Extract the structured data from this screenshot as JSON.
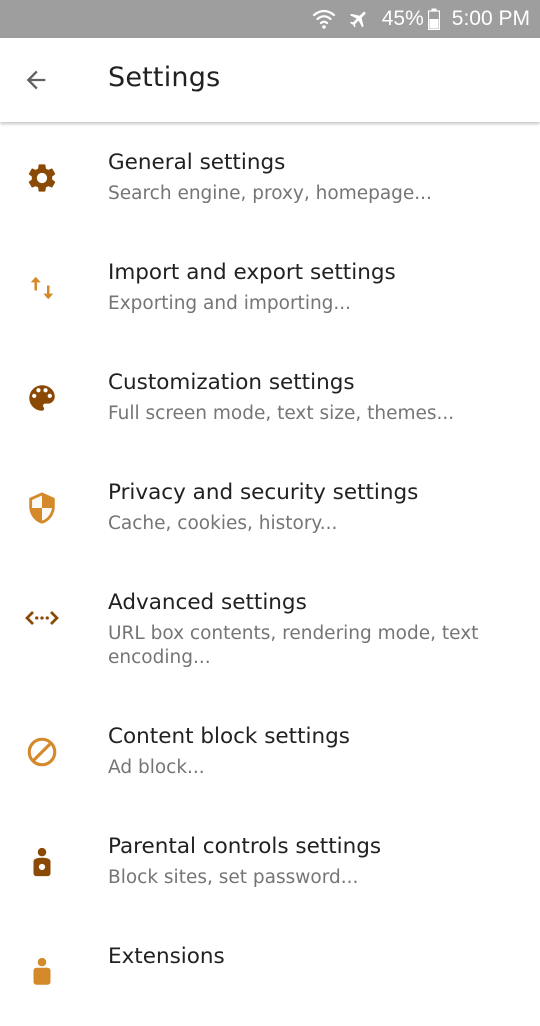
{
  "status_bar": {
    "battery": "45%",
    "time": "5:00 PM",
    "icons": [
      "wifi-icon",
      "airplane-mode-icon",
      "battery-icon"
    ]
  },
  "app_bar": {
    "title": "Settings",
    "back_icon": "back-arrow-icon"
  },
  "colors": {
    "accent_dark": "#8a4a06",
    "accent_light": "#d4892a",
    "status_bar": "#9e9e9e",
    "title_text": "#212121",
    "subtitle_text": "#757575"
  },
  "settings": {
    "items": [
      {
        "title": "General settings",
        "subtitle": "Search engine, proxy, homepage...",
        "icon": "gear-icon"
      },
      {
        "title": "Import and export settings",
        "subtitle": "Exporting and importing...",
        "icon": "import-export-arrows-icon"
      },
      {
        "title": "Customization settings",
        "subtitle": "Full screen mode, text size, themes...",
        "icon": "palette-icon"
      },
      {
        "title": "Privacy and security settings",
        "subtitle": "Cache, cookies, history...",
        "icon": "shield-icon"
      },
      {
        "title": "Advanced settings",
        "subtitle": "URL box contents, rendering mode, text encoding...",
        "icon": "code-arrows-icon"
      },
      {
        "title": "Content block settings",
        "subtitle": "Ad block...",
        "icon": "block-icon"
      },
      {
        "title": "Parental controls settings",
        "subtitle": "Block sites, set password...",
        "icon": "child-icon"
      },
      {
        "title": "Extensions",
        "subtitle": "",
        "icon": "extension-icon"
      }
    ]
  }
}
